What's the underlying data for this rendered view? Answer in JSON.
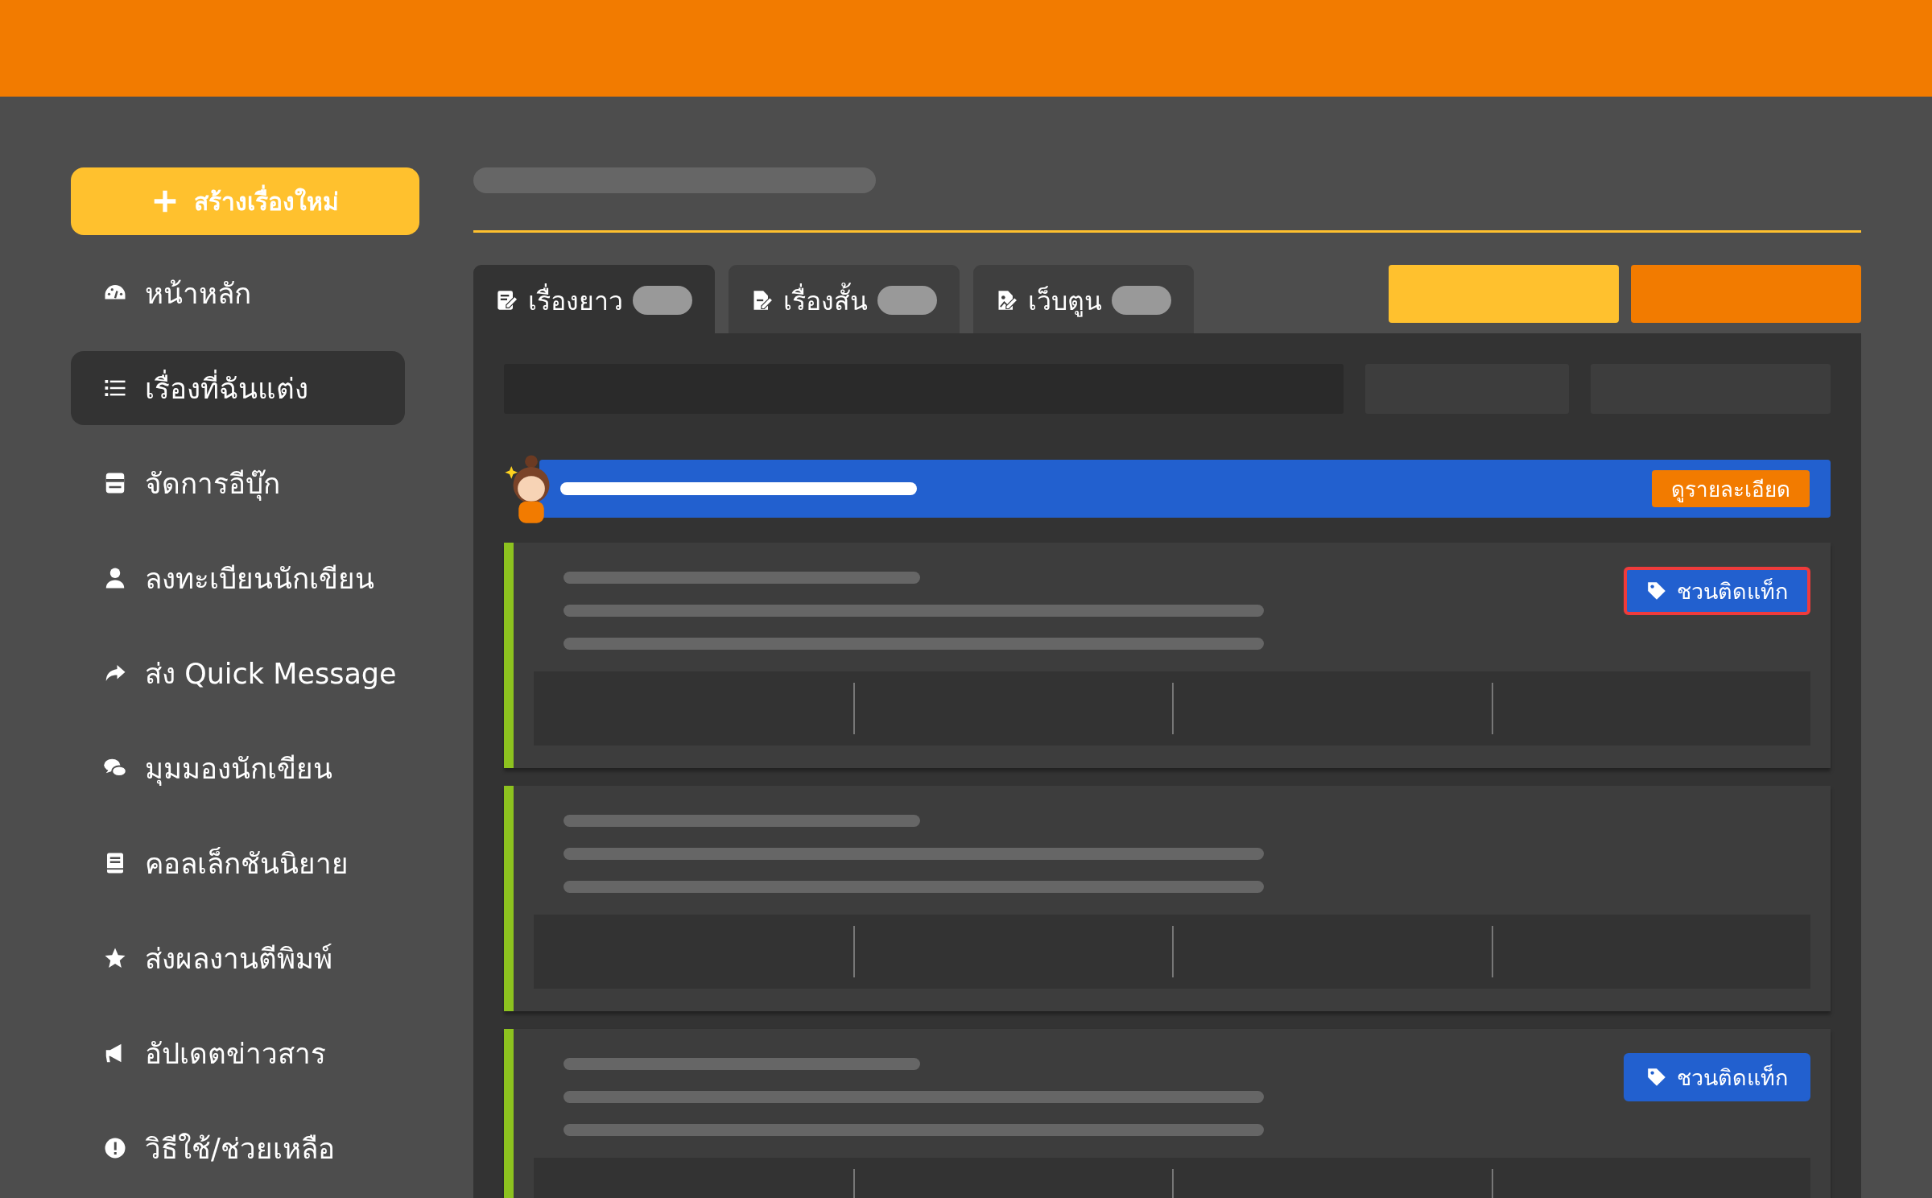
{
  "sidebar": {
    "create_button": {
      "label": "สร้างเรื่องใหม่"
    },
    "items": [
      {
        "label": "หน้าหลัก",
        "selected": false
      },
      {
        "label": "เรื่องที่ฉันแต่ง",
        "selected": true
      },
      {
        "label": "จัดการอีบุ๊ก",
        "selected": false
      },
      {
        "label": "ลงทะเบียนนักเขียน",
        "selected": false
      },
      {
        "label": "ส่ง Quick Message",
        "selected": false
      },
      {
        "label": "มุมมองนักเขียน",
        "selected": false
      },
      {
        "label": "คอลเล็กชันนิยาย",
        "selected": false
      },
      {
        "label": "ส่งผลงานตีพิมพ์",
        "selected": false
      },
      {
        "label": "อัปเดตข่าวสาร",
        "selected": false
      },
      {
        "label": "วิธีใช้/ช่วยเหลือ",
        "selected": false
      }
    ]
  },
  "tabs": [
    {
      "label": "เรื่องยาว",
      "selected": true
    },
    {
      "label": "เรื่องสั้น",
      "selected": false
    },
    {
      "label": "เว็บตูน",
      "selected": false
    }
  ],
  "banner": {
    "button": "ดูรายละเอียด"
  },
  "cards": [
    {
      "kind": "tagged",
      "tag_button": {
        "label": "ชวนติดแท็ก",
        "focused": true
      }
    },
    {
      "kind": "plain"
    },
    {
      "kind": "tagged",
      "tag_button": {
        "label": "ชวนติดแท็ก",
        "focused": false
      }
    }
  ]
}
